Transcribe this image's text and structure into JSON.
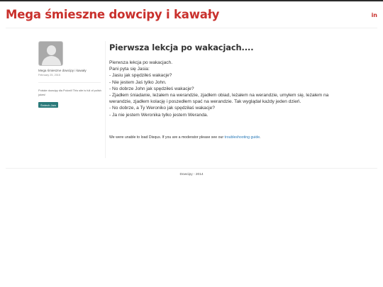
{
  "header": {
    "site_title": "Mega śmieszne dowcipy i kawały",
    "social_linkedin": "in"
  },
  "sidebar": {
    "author": "Mega śmieszne dowcipy i kawały",
    "date": "February 25, 2015",
    "about": "Polskie dowcipy dla Polonii! This site is full of polish jokes!",
    "tag_button": "Śmiech.Jam"
  },
  "article": {
    "title": "Pierwsza lekcja po wakacjach....",
    "lines": [
      "Pierwsza lekcja po wakacjach.",
      "Pani pyta się Jasia:",
      "- Jasiu jak spędziłeś wakacje?",
      "- Nie jestem Jaś tylko John.",
      "- No dobrze John jak spędziłeś wakacje?",
      "- Zjadłem śniadanie, leżałem na werandzie, zjadłem obiad, leżałem na werandzie, umyłem się, leżałem na werandzie, zjadłem kolację i poszedłem spać na werandzie. Tak wyglądał każdy jeden dzień.",
      "- No dobrze, a Ty Weroniko jak spędziłaś wakacje?",
      "- Ja nie jestem Weronika tylko jestem Weranda."
    ]
  },
  "disqus": {
    "message": "We were unable to load Disqus. If you are a moderator please see our",
    "link": "troubleshooting guide",
    "end": "."
  },
  "footer": {
    "text": "Dowcipy - 2014"
  },
  "colors": {
    "brand": "#c9302c",
    "tag_button": "#2a7a7a",
    "link": "#2a7ab8"
  }
}
